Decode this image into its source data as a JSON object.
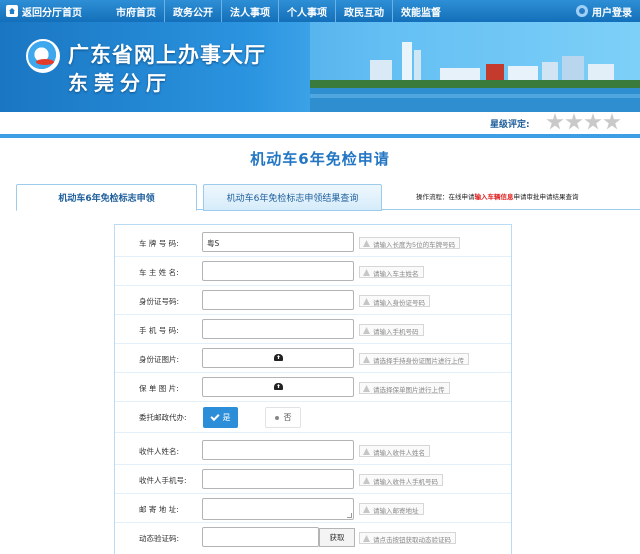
{
  "topbar": {
    "back_label": "返回分厅首页",
    "nav": [
      "市府首页",
      "政务公开",
      "法人事项",
      "个人事项",
      "政民互动",
      "效能监督"
    ],
    "login_label": "用户登录"
  },
  "banner": {
    "title_line1": "广东省网上办事大厅",
    "title_line2": "东莞分厅"
  },
  "rating": {
    "label": "星级评定:",
    "stars": 0,
    "max_stars": 4
  },
  "page_title": "机动车6年免检申请",
  "tabs": {
    "active": "机动车6年免检标志申领",
    "inactive": "机动车6年免检标志申领结果查询"
  },
  "process": {
    "prefix": "操作流程：在线申请",
    "highlight": "输入车辆信息",
    "suffix": "申请审批申请结果查询"
  },
  "form": {
    "plate": {
      "label": "车 牌 号 码:",
      "value": "粤S",
      "hint": "请输入长度为5位的车牌号码"
    },
    "owner": {
      "label": "车 主 姓 名:",
      "hint": "请输入车主姓名"
    },
    "id_number": {
      "label": "身份证号码:",
      "hint": "请输入身份证号码"
    },
    "phone": {
      "label": "手 机 号 码:",
      "hint": "请输入手机号码"
    },
    "id_photo": {
      "label": "身份证图片:",
      "hint": "请选择手持身份证图片进行上传"
    },
    "policy_photo": {
      "label": "保 单 图 片:",
      "hint": "请选择保单图片进行上传"
    },
    "postal_agent": {
      "label": "委托邮政代办:",
      "yes": "是",
      "no": "否",
      "selected": "是"
    },
    "recipient_name": {
      "label": "收件人姓名:",
      "hint": "请输入收件人姓名"
    },
    "recipient_phone": {
      "label": "收件人手机号:",
      "hint": "请输入收件人手机号码"
    },
    "address": {
      "label": "邮 寄 地 址:",
      "hint": "请输入邮寄地址"
    },
    "captcha": {
      "label": "动态验证码:",
      "button": "获取",
      "hint": "请点击按钮获取动态验证码"
    }
  }
}
